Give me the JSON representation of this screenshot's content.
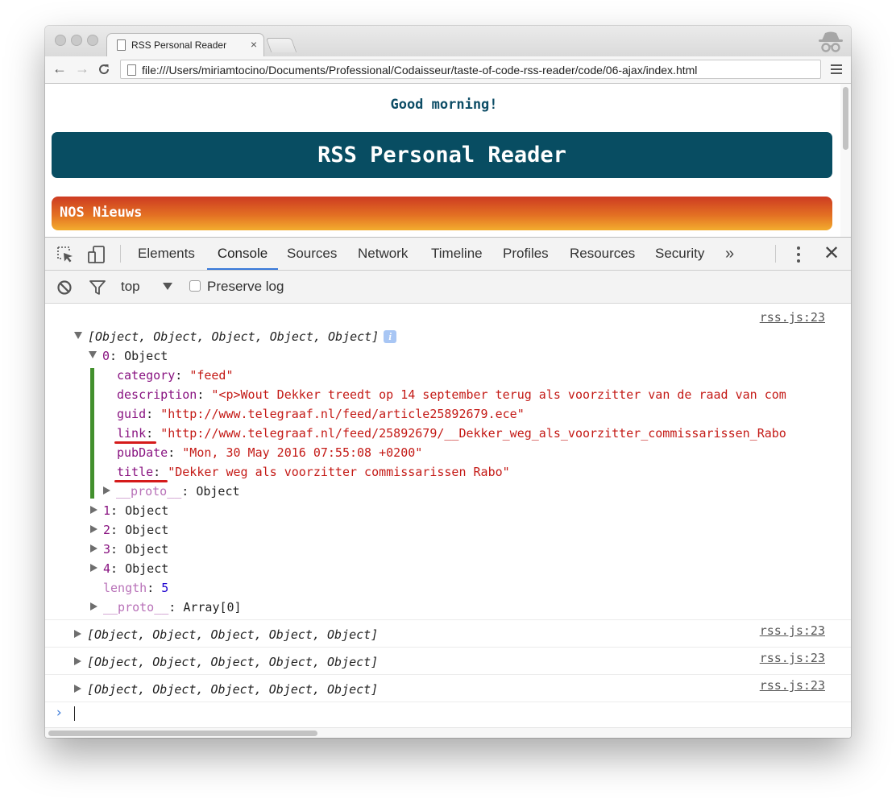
{
  "browser": {
    "tab_title": "RSS Personal Reader",
    "tab_close": "×",
    "address_url": "file:///Users/miriamtocino/Documents/Professional/Codaisseur/taste-of-code-rss-reader/code/06-ajax/index.html",
    "nav": {
      "back": "←",
      "forward": "→",
      "reload": "C"
    }
  },
  "page": {
    "greeting": "Good morning!",
    "banner_title": "RSS Personal Reader",
    "feed_title": "NOS Nieuws"
  },
  "devtools": {
    "tabs": [
      "Elements",
      "Console",
      "Sources",
      "Network",
      "Timeline",
      "Profiles",
      "Resources",
      "Security"
    ],
    "active_tab": "Console",
    "more_tabs": "»",
    "close": "✕",
    "filter": {
      "context": "top",
      "preserve_log_label": "Preserve log",
      "preserve_log_checked": false
    },
    "console": {
      "source_link": "rss.js:23",
      "array_summary": "[Object, Object, Object, Object, Object]",
      "info_badge": "i",
      "expanded_index": "0",
      "object_label": "Object",
      "properties": [
        {
          "key": "category",
          "value": "\"feed\""
        },
        {
          "key": "description",
          "value": "\"<p>Wout Dekker treedt op 14 september terug als voorzitter van de raad van com"
        },
        {
          "key": "guid",
          "value": "\"http://www.telegraaf.nl/feed/article25892679.ece\""
        },
        {
          "key": "link",
          "value": "\"http://www.telegraaf.nl/feed/25892679/__Dekker_weg_als_voorzitter_commissarissen_Rabo"
        },
        {
          "key": "pubDate",
          "value": "\"Mon, 30 May 2016 07:55:08 +0200\""
        },
        {
          "key": "title",
          "value": "\"Dekker weg als voorzitter commissarissen Rabo\""
        }
      ],
      "proto_key": "__proto__",
      "proto_object_value": "Object",
      "collapsed_items": [
        "1",
        "2",
        "3",
        "4"
      ],
      "length_key": "length",
      "length_value": "5",
      "array_proto_value": "Array[0]",
      "prompt": "›"
    }
  },
  "colors": {
    "banner": "#084d62",
    "feed_gradient_top": "#cd3b22",
    "feed_gradient_bottom": "#f3ad2e",
    "active_tab_underline": "#3879d9",
    "string_value": "#c41a16",
    "property_key": "#881280",
    "number_value": "#1c00cf",
    "expanded_object_bar": "#42902d",
    "highlight_underline": "#d51a1a"
  }
}
